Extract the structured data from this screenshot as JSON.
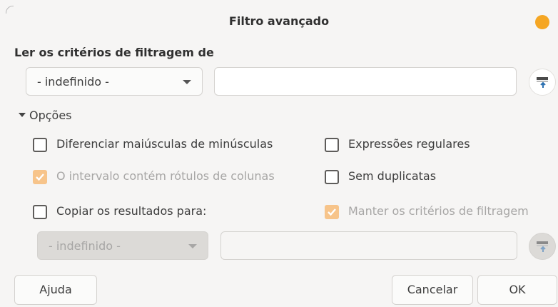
{
  "dialog": {
    "title": "Filtro avançado"
  },
  "criteria": {
    "label": "Ler os critérios de filtragem de",
    "source_value": "- indefinido -",
    "range_value": ""
  },
  "options": {
    "toggle_label": "Opções",
    "case_sensitive": {
      "label": "Diferenciar maiúsculas de minúsculas",
      "checked": false,
      "enabled": true
    },
    "regex": {
      "label": "Expressões regulares",
      "checked": false,
      "enabled": true
    },
    "header_labels": {
      "label": "O intervalo contém rótulos de colunas",
      "checked": true,
      "enabled": false
    },
    "no_duplicates": {
      "label": "Sem duplicatas",
      "checked": false,
      "enabled": true
    },
    "copy_results": {
      "label": "Copiar os resultados para:",
      "checked": false,
      "enabled": true
    },
    "keep_criteria": {
      "label": "Manter os critérios de filtragem",
      "checked": true,
      "enabled": false
    },
    "copy_target_value": "- indefinido -",
    "copy_range_value": ""
  },
  "buttons": {
    "help": "Ajuda",
    "cancel": "Cancelar",
    "ok": "OK"
  },
  "colors": {
    "accent": "#f5a623",
    "checked_disabled": "#f7c48a",
    "window_bg": "#f6f5f4"
  },
  "icons": {
    "shrink": "shrink-dialog-icon",
    "window_control": "window-control-dot"
  }
}
